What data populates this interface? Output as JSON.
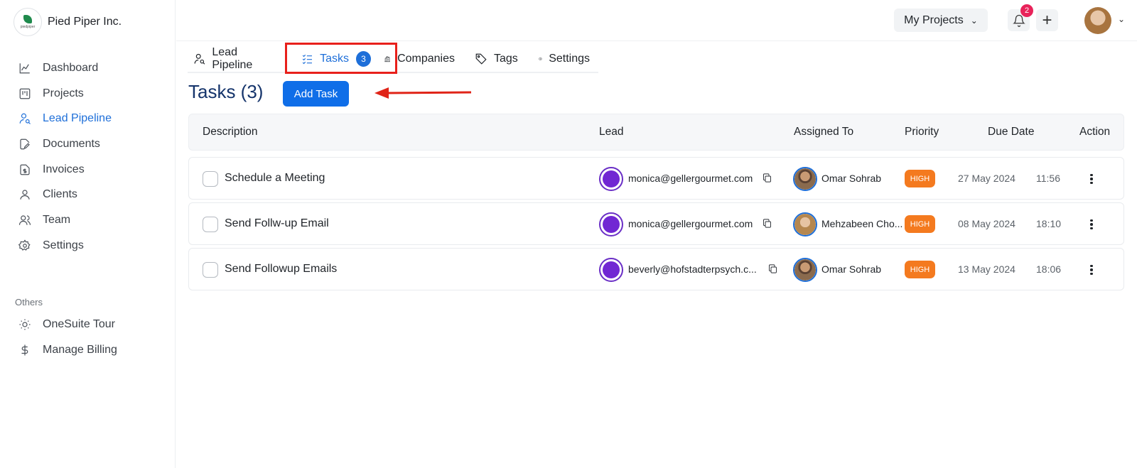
{
  "brand": {
    "name": "Pied Piper Inc.",
    "logo_text": "piedpiper"
  },
  "sidebar": {
    "items": [
      {
        "label": "Dashboard",
        "icon": "chart-line-icon"
      },
      {
        "label": "Projects",
        "icon": "kanban-icon"
      },
      {
        "label": "Lead Pipeline",
        "icon": "user-search-icon",
        "active": true
      },
      {
        "label": "Documents",
        "icon": "document-edit-icon"
      },
      {
        "label": "Invoices",
        "icon": "invoice-icon"
      },
      {
        "label": "Clients",
        "icon": "user-icon"
      },
      {
        "label": "Team",
        "icon": "users-icon"
      },
      {
        "label": "Settings",
        "icon": "gear-icon"
      }
    ],
    "others_label": "Others",
    "others": [
      {
        "label": "OneSuite Tour",
        "icon": "sun-icon"
      },
      {
        "label": "Manage Billing",
        "icon": "dollar-icon"
      }
    ]
  },
  "topbar": {
    "projects_label": "My Projects",
    "notifications_count": "2"
  },
  "tabs": [
    {
      "label": "Lead Pipeline"
    },
    {
      "label": "Tasks",
      "count": "3",
      "active": true
    },
    {
      "label": "Companies"
    },
    {
      "label": "Tags"
    },
    {
      "label": "Settings"
    }
  ],
  "page": {
    "title": "Tasks (3)",
    "add_button": "Add Task"
  },
  "table": {
    "headers": [
      "Description",
      "Lead",
      "Assigned To",
      "Priority",
      "Due Date",
      "Action"
    ],
    "rows": [
      {
        "description": "Schedule a Meeting",
        "lead": "monica@gellergourmet.com",
        "assignee": "Omar Sohrab",
        "priority": "HIGH",
        "date": "27 May 2024",
        "time": "11:56"
      },
      {
        "description": "Send Follw-up Email",
        "lead": "monica@gellergourmet.com",
        "assignee": "Mehzabeen Cho...",
        "priority": "HIGH",
        "date": "08 May 2024",
        "time": "18:10"
      },
      {
        "description": "Send Followup Emails",
        "lead": "beverly@hofstadterpsych.c...",
        "assignee": "Omar Sohrab",
        "priority": "HIGH",
        "date": "13 May 2024",
        "time": "18:06"
      }
    ]
  },
  "colors": {
    "accent": "#1e6fd9",
    "priority_high": "#f47a1f",
    "lead_avatar": "#7127d3",
    "highlight": "#e8201b"
  }
}
